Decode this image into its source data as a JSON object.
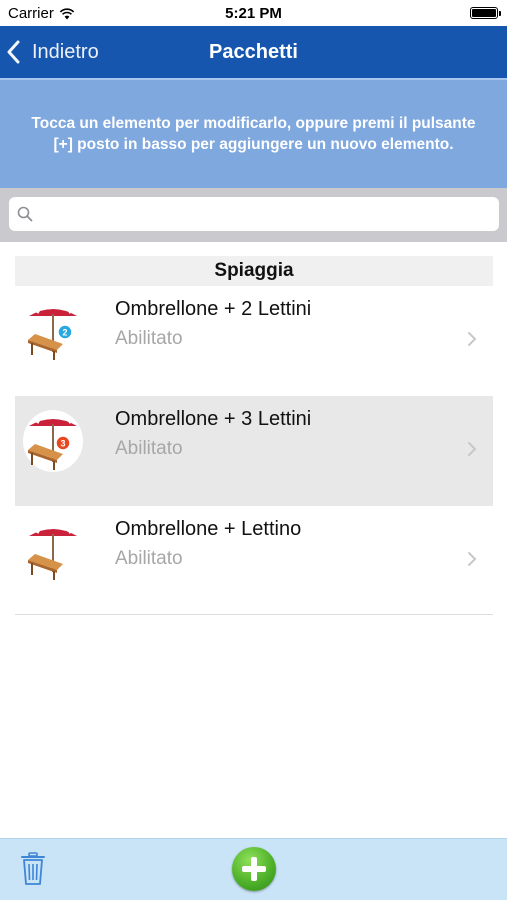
{
  "status_bar": {
    "carrier": "Carrier",
    "time": "5:21 PM"
  },
  "nav": {
    "back_label": "Indietro",
    "title": "Pacchetti"
  },
  "info_banner": {
    "text": "Tocca un elemento per modificarlo, oppure premi il pulsante [+] posto in basso per aggiungere un nuovo elemento."
  },
  "search": {
    "placeholder": "",
    "value": ""
  },
  "section": {
    "title": "Spiaggia"
  },
  "items": [
    {
      "title": "Ombrellone + 2 Lettini",
      "subtitle": "Abilitato",
      "badge": "2",
      "badge_color": "#29a8e0",
      "selected": false
    },
    {
      "title": "Ombrellone + 3 Lettini",
      "subtitle": "Abilitato",
      "badge": "3",
      "badge_color": "#e8471f",
      "selected": true
    },
    {
      "title": "Ombrellone + Lettino",
      "subtitle": "Abilitato",
      "badge": "",
      "badge_color": "",
      "selected": false
    }
  ],
  "colors": {
    "nav": "#1656ae",
    "banner": "#7fa8de",
    "toolbar": "#c9e3f7",
    "accent": "#4fb22a"
  },
  "icons": [
    "wifi-icon",
    "battery-icon",
    "back-chevron-icon",
    "search-icon",
    "umbrella-lounger-icon",
    "chevron-right-icon",
    "trash-icon",
    "add-icon"
  ]
}
